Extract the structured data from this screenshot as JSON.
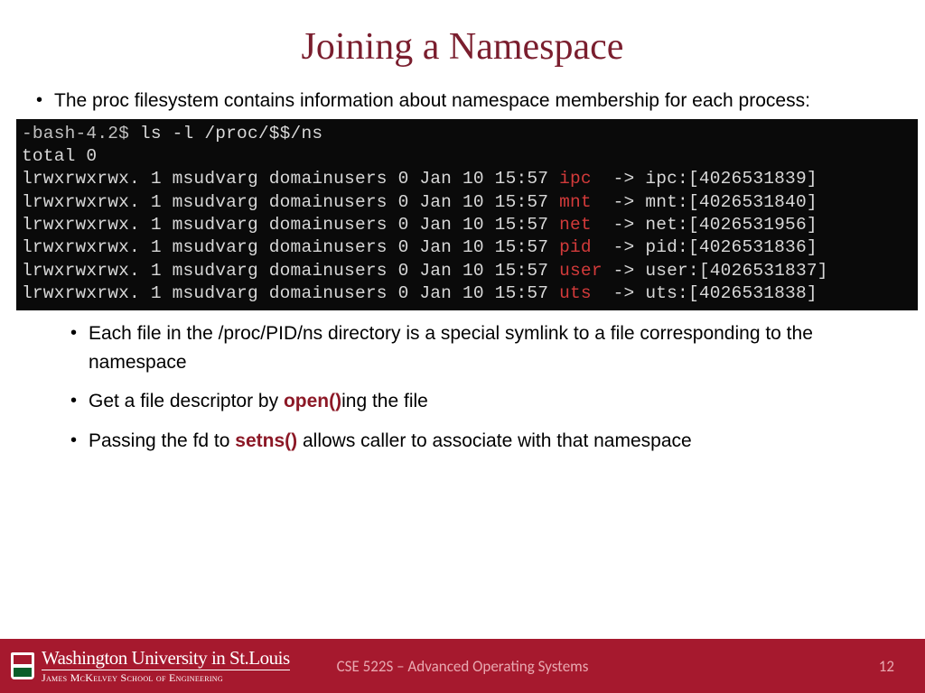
{
  "title": "Joining a Namespace",
  "bullet1": "The proc filesystem contains information about namespace membership for each process:",
  "terminal": {
    "prompt": "-bash-4.2$ ",
    "cmd": "ls -l /proc/$$/ns",
    "total": "total 0",
    "rows": [
      {
        "perm": "lrwxrwxrwx. 1 msudvarg domainusers 0 Jan 10 15:57 ",
        "ns": "ipc",
        "arrow": "  -> ipc:[4026531839]"
      },
      {
        "perm": "lrwxrwxrwx. 1 msudvarg domainusers 0 Jan 10 15:57 ",
        "ns": "mnt",
        "arrow": "  -> mnt:[4026531840]"
      },
      {
        "perm": "lrwxrwxrwx. 1 msudvarg domainusers 0 Jan 10 15:57 ",
        "ns": "net",
        "arrow": "  -> net:[4026531956]"
      },
      {
        "perm": "lrwxrwxrwx. 1 msudvarg domainusers 0 Jan 10 15:57 ",
        "ns": "pid",
        "arrow": "  -> pid:[4026531836]"
      },
      {
        "perm": "lrwxrwxrwx. 1 msudvarg domainusers 0 Jan 10 15:57 ",
        "ns": "user",
        "arrow": " -> user:[4026531837]"
      },
      {
        "perm": "lrwxrwxrwx. 1 msudvarg domainusers 0 Jan 10 15:57 ",
        "ns": "uts",
        "arrow": "  -> uts:[4026531838]"
      }
    ]
  },
  "bullet2": "Each file in the /proc/PID/ns directory is a special symlink to a file corresponding to the namespace",
  "bullet3a": "Get a file descriptor by ",
  "bullet3b": "open()",
  "bullet3c": "ing the file",
  "bullet4a": "Passing the fd to ",
  "bullet4b": "setns()",
  "bullet4c": " allows caller to associate with that namespace",
  "footer": {
    "uni_top": "Washington University in St.Louis",
    "uni_bottom": "James McKelvey School of Engineering",
    "course": "CSE 522S – Advanced Operating Systems",
    "page": "12"
  }
}
